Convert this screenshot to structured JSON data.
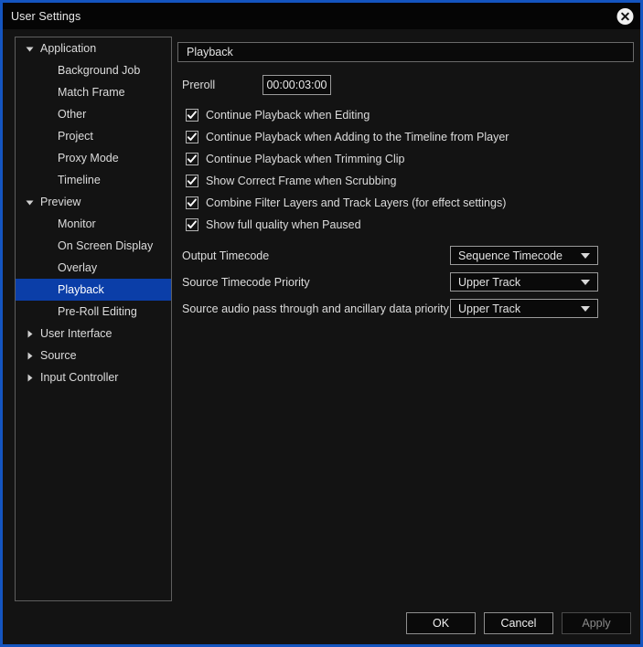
{
  "window": {
    "title": "User Settings",
    "close_icon": "close-circle-icon",
    "border_color": "#1455c0",
    "background": "#131313"
  },
  "sidebar": {
    "items": [
      {
        "label": "Application",
        "level": "group",
        "state": "expanded",
        "selected": false
      },
      {
        "label": "Background Job",
        "level": "child",
        "state": "none",
        "selected": false
      },
      {
        "label": "Match Frame",
        "level": "child",
        "state": "none",
        "selected": false
      },
      {
        "label": "Other",
        "level": "child",
        "state": "none",
        "selected": false
      },
      {
        "label": "Project",
        "level": "child",
        "state": "none",
        "selected": false
      },
      {
        "label": "Proxy Mode",
        "level": "child",
        "state": "none",
        "selected": false
      },
      {
        "label": "Timeline",
        "level": "child",
        "state": "none",
        "selected": false
      },
      {
        "label": "Preview",
        "level": "group",
        "state": "expanded",
        "selected": false
      },
      {
        "label": "Monitor",
        "level": "child",
        "state": "none",
        "selected": false
      },
      {
        "label": "On Screen Display",
        "level": "child",
        "state": "none",
        "selected": false
      },
      {
        "label": "Overlay",
        "level": "child",
        "state": "none",
        "selected": false
      },
      {
        "label": "Playback",
        "level": "child",
        "state": "none",
        "selected": true
      },
      {
        "label": "Pre-Roll Editing",
        "level": "child",
        "state": "none",
        "selected": false
      },
      {
        "label": "User Interface",
        "level": "group",
        "state": "collapsed",
        "selected": false
      },
      {
        "label": "Source",
        "level": "group",
        "state": "collapsed",
        "selected": false
      },
      {
        "label": "Input Controller",
        "level": "group",
        "state": "collapsed",
        "selected": false
      }
    ],
    "selection_color": "#0b3ea8"
  },
  "panel": {
    "header": "Playback",
    "preroll": {
      "label": "Preroll",
      "value": "00:00:03:00",
      "placeholder": "00:00:00:00"
    },
    "checkboxes": [
      {
        "label": "Continue Playback when Editing",
        "checked": true
      },
      {
        "label": "Continue Playback when Adding to the Timeline from Player",
        "checked": true
      },
      {
        "label": "Continue Playback when Trimming Clip",
        "checked": true
      },
      {
        "label": "Show Correct Frame when Scrubbing",
        "checked": true
      },
      {
        "label": "Combine Filter Layers and Track Layers (for effect settings)",
        "checked": true
      },
      {
        "label": "Show full quality when Paused",
        "checked": true
      }
    ],
    "selects": [
      {
        "label": "Output Timecode",
        "value": "Sequence Timecode"
      },
      {
        "label": "Source Timecode Priority",
        "value": "Upper Track"
      },
      {
        "label": "Source audio pass through and ancillary data priority",
        "value": "Upper Track"
      }
    ]
  },
  "footer": {
    "ok_label": "OK",
    "cancel_label": "Cancel",
    "apply_label": "Apply",
    "apply_disabled": true
  }
}
